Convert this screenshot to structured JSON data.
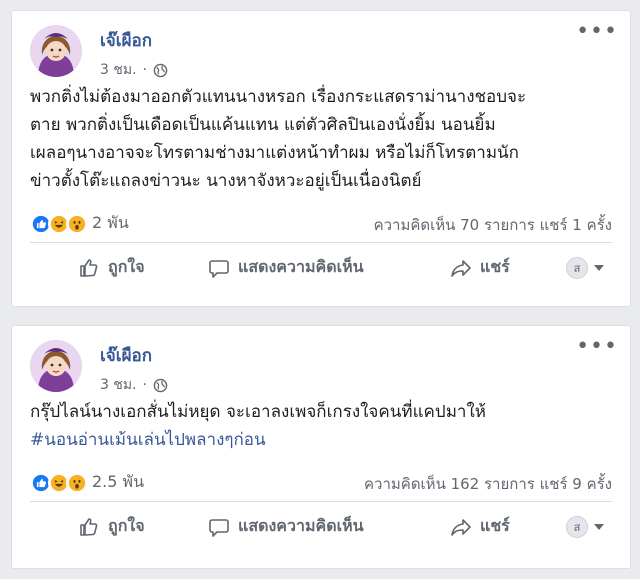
{
  "posts": [
    {
      "author": "เจ๊เผือก",
      "time": "3 ชม.",
      "separator": "·",
      "privacy_icon": "globe-icon",
      "text_lines": [
        "พวกติ่งไม่ต้องมาออกตัวแทนนางหรอก เรื่องกระแสดราม่านางชอบจะ",
        "ตาย พวกติ่งเป็นเดือดเป็นแค้นแทน แต่ตัวศิลปินเองนั่งยิ้ม นอนยิ้ม",
        "เผลอๆนางอาจจะโทรตามช่างมาแต่งหน้าทำผม หรือไม่ก็โทรตามนัก",
        "ข่าวตั้งโต๊ะแถลงข่าวนะ นางหาจังหวะอยู่เป็นเนื่องนิตย์"
      ],
      "hashtag": "",
      "reaction_count": "2 พัน",
      "comment_share": "ความคิดเห็น 70 รายการ  แชร์ 1 ครั้ง",
      "actions": {
        "like": "ถูกใจ",
        "comment": "แสดงความคิดเห็น",
        "share": "แชร์"
      },
      "audience_avatar_text": "ส"
    },
    {
      "author": "เจ๊เผือก",
      "time": "3 ชม.",
      "separator": "·",
      "privacy_icon": "globe-icon",
      "text_lines": [
        "กรุ๊ปไลน์นางเอกสั่นไม่หยุด จะเอาลงเพจก็เกรงใจคนที่แคปมาให้"
      ],
      "hashtag": "#นอนอ่านเม้นเล่นไปพลางๆก่อน",
      "reaction_count": "2.5 พัน",
      "comment_share": "ความคิดเห็น 162 รายการ  แชร์ 9 ครั้ง",
      "actions": {
        "like": "ถูกใจ",
        "comment": "แสดงความคิดเห็น",
        "share": "แชร์"
      },
      "audience_avatar_text": "ส"
    }
  ],
  "colors": {
    "link_blue": "#385898",
    "meta_gray": "#616770",
    "like_blue": "#1877f2",
    "reaction_yellow": "#f7b125",
    "background": "#e9ebee"
  }
}
